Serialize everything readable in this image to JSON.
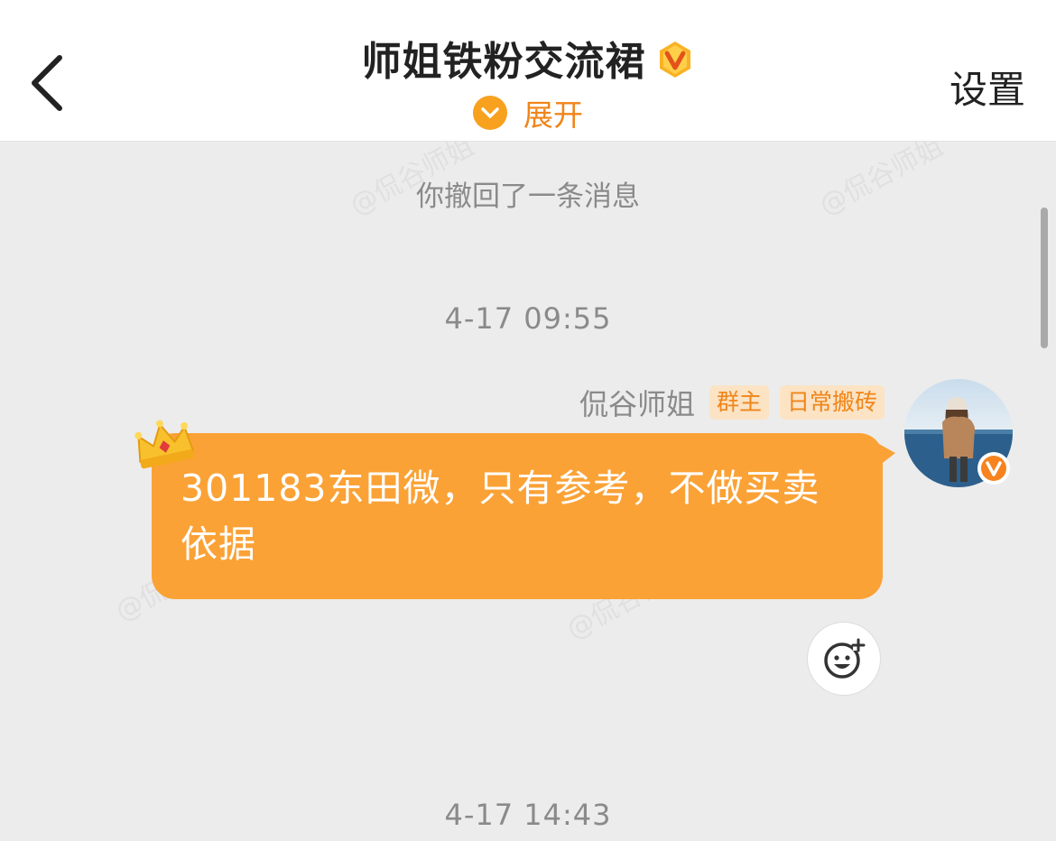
{
  "header": {
    "title": "师姐铁粉交流裙",
    "expand_label": "展开",
    "settings_label": "设置",
    "back_icon": "chevron-left-icon",
    "title_badge_icon": "vip-v-badge-icon"
  },
  "watermark": {
    "text": "@侃谷师姐"
  },
  "chat": {
    "system_notice": "你撤回了一条消息",
    "timestamp_1": "4-17 09:55",
    "message": {
      "sender": "侃谷师姐",
      "tags": [
        "群主",
        "日常搬砖"
      ],
      "text": "301183东田微，只有参考，不做买卖依据",
      "decoration_icon": "crown-icon",
      "reaction_icon": "add-emoji-icon"
    },
    "timestamp_2": "4-17 14:43"
  },
  "colors": {
    "accent_orange": "#f7a11f",
    "bubble": "#fba236",
    "tag_text": "#f08519",
    "tag_bg": "#fbe3c4",
    "background": "#ececec"
  }
}
